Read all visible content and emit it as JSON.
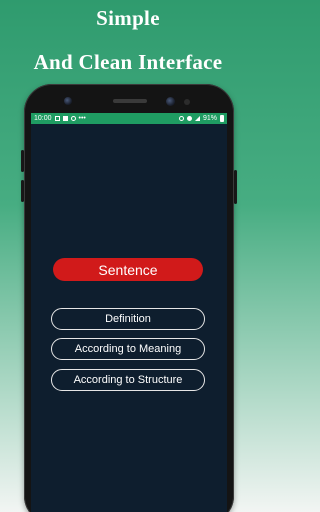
{
  "promo": {
    "line1": "Simple",
    "line2": "And Clean Interface"
  },
  "status_bar": {
    "time": "10:00",
    "battery": "91%",
    "bg_color": "#1f9c62"
  },
  "app": {
    "background_color": "#0e1e2e",
    "primary_button": {
      "label": "Sentence",
      "color": "#d11a1a"
    },
    "options": [
      {
        "label": "Definition"
      },
      {
        "label": "According to Meaning"
      },
      {
        "label": "According to Structure"
      }
    ]
  }
}
